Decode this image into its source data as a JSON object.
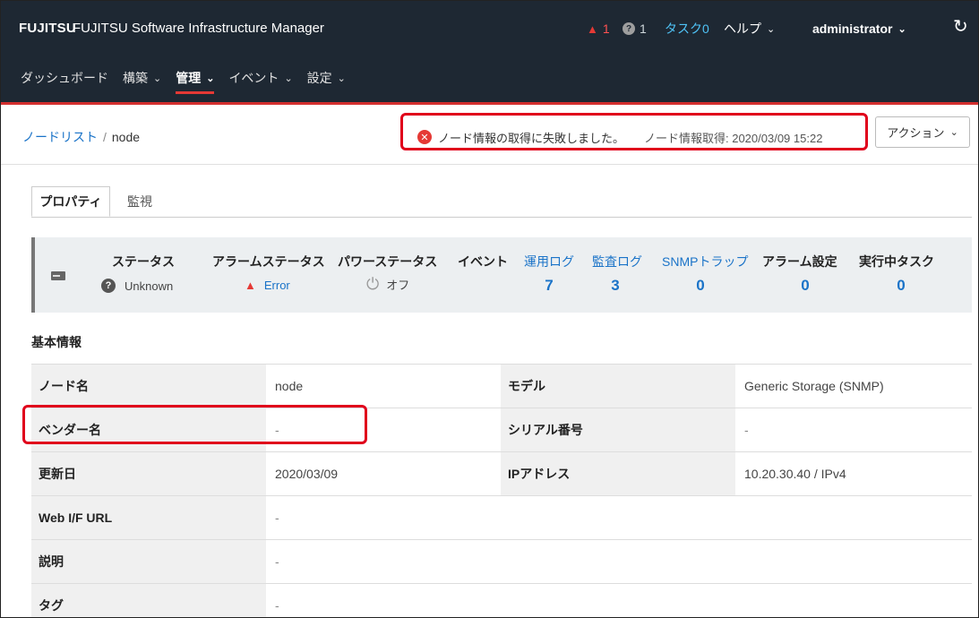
{
  "header": {
    "logo": "FUJITSU",
    "app_title": "FUJITSU Software Infrastructure Manager",
    "alarm_count": "1",
    "unknown_count": "1",
    "task_label": "タスク0",
    "help_label": "ヘルプ",
    "user_label": "administrator",
    "icons": {
      "alarm": "bell-icon",
      "unknown": "question-icon",
      "refresh": "refresh-icon"
    }
  },
  "nav": {
    "items": [
      "ダッシュボード",
      "構築",
      "管理",
      "イベント",
      "設定"
    ],
    "active": "管理"
  },
  "breadcrumb": {
    "link": "ノードリスト",
    "separator": "/",
    "current": "node"
  },
  "notice": {
    "error_message": "ノード情報の取得に失敗しました。",
    "fetch_label": "ノード情報取得: 2020/03/09 15:22"
  },
  "action_button": "アクション",
  "tabs": [
    "プロパティ",
    "監視"
  ],
  "status_strip": {
    "status_label": "ステータス",
    "status_value": "Unknown",
    "alarm_status_label": "アラームステータス",
    "alarm_status_value": "Error",
    "power_status_label": "パワーステータス",
    "power_status_value": "オフ",
    "event_label": "イベント",
    "op_log_label": "運用ログ",
    "op_log_count": "7",
    "audit_log_label": "監査ログ",
    "audit_log_count": "3",
    "snmp_label": "SNMPトラップ",
    "snmp_count": "0",
    "alarm_setting_label": "アラーム設定",
    "alarm_setting_count": "0",
    "running_task_label": "実行中タスク",
    "running_task_count": "0"
  },
  "basic_info": {
    "title": "基本情報",
    "rows": [
      {
        "k1": "ノード名",
        "v1": "node",
        "k2": "モデル",
        "v2": "Generic Storage (SNMP)"
      },
      {
        "k1": "ベンダー名",
        "v1": "-",
        "k2": "シリアル番号",
        "v2": "-"
      },
      {
        "k1": "更新日",
        "v1": "2020/03/09",
        "k2": "IPアドレス",
        "v2": "10.20.30.40 / IPv4"
      },
      {
        "k1": "Web I/F URL",
        "v1": "-"
      },
      {
        "k1": "説明",
        "v1": "-"
      },
      {
        "k1": "タグ",
        "v1": "-"
      }
    ]
  },
  "colors": {
    "header_bg": "#1e2833",
    "accent_red": "#d32f2f",
    "link_blue": "#1a73c8",
    "highlight_red": "#e0001b"
  }
}
